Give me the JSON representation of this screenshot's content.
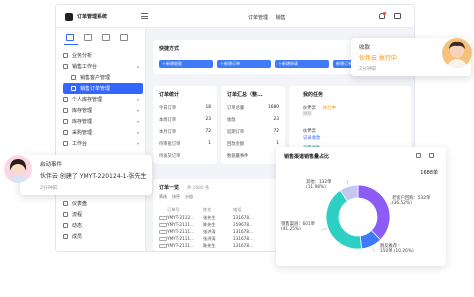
{
  "app": {
    "title": "订单管理系统"
  },
  "topbar": {
    "nav_label": "订单管理",
    "nav_selected": "销售"
  },
  "sidebar": {
    "items": [
      {
        "label": "业务分析",
        "level": 1
      },
      {
        "label": "销售工作台",
        "level": 1
      },
      {
        "label": "销售客户管理",
        "level": 2
      },
      {
        "label": "销售订单管理",
        "level": 2,
        "active": true
      },
      {
        "label": "个人库存管理",
        "level": 1
      },
      {
        "label": "库存管理",
        "level": 1
      },
      {
        "label": "库存管理",
        "level": 1
      },
      {
        "label": "采购管理",
        "level": 1
      },
      {
        "label": "工作台",
        "level": 1
      }
    ],
    "bottom_items": [
      {
        "label": "仪表盘"
      },
      {
        "label": "流程"
      },
      {
        "label": "动态"
      },
      {
        "label": "成员"
      }
    ]
  },
  "quick": {
    "title": "快捷方式",
    "buttons": [
      "新增收款",
      "新增订单",
      "新增申请",
      "新增订单"
    ]
  },
  "order_stats": {
    "title": "订单统计",
    "rows": [
      {
        "k": "今日订单",
        "v": "18"
      },
      {
        "k": "本周订单",
        "v": "23"
      },
      {
        "k": "本月订单",
        "v": "72"
      },
      {
        "k": "待审批订单",
        "v": "1"
      },
      {
        "k": "待发货订单",
        "v": ""
      }
    ]
  },
  "order_summary": {
    "title": "订单汇总（整...",
    "rows": [
      {
        "k": "订单总量",
        "v": "1680"
      },
      {
        "k": "收款",
        "v": "23"
      },
      {
        "k": "延期订单",
        "v": "72"
      },
      {
        "k": "回款金额",
        "v": "1"
      },
      {
        "k": "数据量事件",
        "v": ""
      }
    ]
  },
  "my_tasks": {
    "title": "我的任务",
    "items": [
      {
        "who": "伙伴云",
        "status": "执行中",
        "time": "刚刚",
        "color": "orange"
      },
      {
        "who": "伙伴云",
        "status": "记录收款",
        "time": "",
        "color": "blue"
      },
      {
        "who": "",
        "status": "无需收款",
        "time": "",
        "color": "green"
      }
    ]
  },
  "order_list": {
    "title": "订单一览",
    "count": "共 1680 条",
    "toolbar": [
      "筛选",
      "排序",
      "分组"
    ],
    "headers": [
      "",
      "订单号",
      "姓名",
      "电话"
    ],
    "rows": [
      [
        "1",
        "YMYT-2112...",
        "张先生",
        "131678..."
      ],
      [
        "2",
        "YMYT-2111...",
        "陈先生",
        "159678..."
      ],
      [
        "3",
        "YMYT-2111...",
        "张洪涛",
        "131678..."
      ],
      [
        "4",
        "YMYT-2111...",
        "张洪涛",
        "131678..."
      ],
      [
        "5",
        "YMYT-2111...",
        "陈先生",
        "131678..."
      ]
    ]
  },
  "notif_right": {
    "title": "收款",
    "body": "伙伴云 执行中",
    "time": "2分钟前"
  },
  "notif_left": {
    "title": "启动事件",
    "body": "伙伴云 创建了 YMYT-220124-1-张先生",
    "time": "2分钟前"
  },
  "chart_data": {
    "type": "donut",
    "title": "销售渠道销售量占比",
    "units": "1688单",
    "slices": [
      {
        "name": "老客户回购",
        "count": 532,
        "label": "532单",
        "percent": "36.52%",
        "color": "#8b5cf6"
      },
      {
        "name": "朋友推荐",
        "count": 150,
        "label": "150单",
        "percent": "10.26%",
        "color": "#3d7bfa"
      },
      {
        "name": "销售渠道",
        "count": 601,
        "label": "601单",
        "percent": "41.25%",
        "color": "#2ecfc4"
      },
      {
        "name": "其他",
        "count": 132,
        "label": "132单",
        "percent": "11.98%",
        "color": "#c4c8f0"
      }
    ]
  }
}
